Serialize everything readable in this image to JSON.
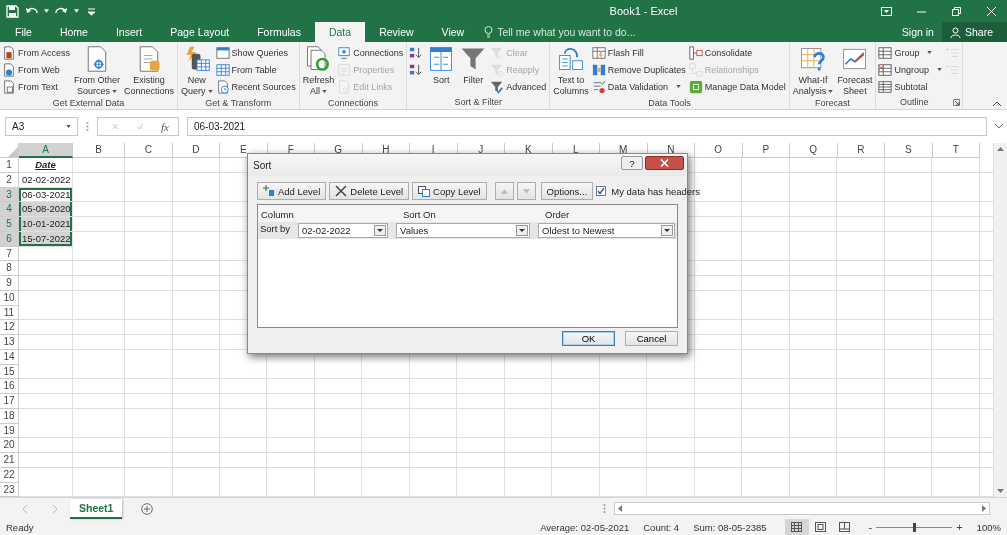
{
  "title_bar": {
    "title": "Book1 - Excel"
  },
  "tabs": [
    {
      "label": "File",
      "selected": false
    },
    {
      "label": "Home",
      "selected": false
    },
    {
      "label": "Insert",
      "selected": false
    },
    {
      "label": "Page Layout",
      "selected": false
    },
    {
      "label": "Formulas",
      "selected": false
    },
    {
      "label": "Data",
      "selected": true
    },
    {
      "label": "Review",
      "selected": false
    },
    {
      "label": "View",
      "selected": false
    }
  ],
  "tell_me": {
    "placeholder": "Tell me what you want to do..."
  },
  "account": {
    "sign_in": "Sign in",
    "share": "Share"
  },
  "ribbon": {
    "groups": [
      {
        "label": "Get External Data",
        "launcher": false,
        "items": [
          {
            "kind": "stack",
            "items": [
              {
                "label": "From Access",
                "disabled": false,
                "dropdown": false
              },
              {
                "label": "From Web",
                "disabled": false,
                "dropdown": false
              },
              {
                "label": "From Text",
                "disabled": false,
                "dropdown": false
              }
            ]
          },
          {
            "kind": "big",
            "lines": [
              "From Other",
              "Sources"
            ],
            "dropdown": true
          },
          {
            "kind": "big",
            "lines": [
              "Existing",
              "Connections"
            ],
            "dropdown": false
          }
        ]
      },
      {
        "label": "Get & Transform",
        "launcher": false,
        "items": [
          {
            "kind": "big",
            "lines": [
              "New",
              "Query"
            ],
            "dropdown": true
          },
          {
            "kind": "stack",
            "items": [
              {
                "label": "Show Queries",
                "disabled": false,
                "dropdown": false
              },
              {
                "label": "From Table",
                "disabled": false,
                "dropdown": false
              },
              {
                "label": "Recent Sources",
                "disabled": false,
                "dropdown": false
              }
            ]
          }
        ]
      },
      {
        "label": "Connections",
        "launcher": false,
        "items": [
          {
            "kind": "big",
            "lines": [
              "Refresh",
              "All"
            ],
            "dropdown": true
          },
          {
            "kind": "stack",
            "items": [
              {
                "label": "Connections",
                "disabled": false,
                "dropdown": false
              },
              {
                "label": "Properties",
                "disabled": true,
                "dropdown": false
              },
              {
                "label": "Edit Links",
                "disabled": true,
                "dropdown": false
              }
            ]
          }
        ]
      },
      {
        "label": "Sort & Filter",
        "launcher": false,
        "items": [
          {
            "kind": "stack",
            "items": [
              {
                "disabled": false,
                "dropdown": false
              },
              {
                "disabled": false,
                "dropdown": false
              }
            ]
          },
          {
            "kind": "big",
            "lines": [
              "Sort"
            ],
            "dropdown": false
          },
          {
            "kind": "big",
            "lines": [
              "Filter"
            ],
            "dropdown": false
          },
          {
            "kind": "stack",
            "items": [
              {
                "label": "Clear",
                "disabled": true,
                "dropdown": false
              },
              {
                "label": "Reapply",
                "disabled": true,
                "dropdown": false
              },
              {
                "label": "Advanced",
                "disabled": false,
                "dropdown": false
              }
            ]
          }
        ]
      },
      {
        "label": "Data Tools",
        "launcher": false,
        "items": [
          {
            "kind": "big",
            "lines": [
              "Text to",
              "Columns"
            ],
            "dropdown": false
          },
          {
            "kind": "stack",
            "items": [
              {
                "label": "Flash Fill",
                "disabled": false,
                "dropdown": false
              },
              {
                "label": "Remove Duplicates",
                "disabled": false,
                "dropdown": false
              },
              {
                "label": "Data Validation",
                "disabled": false,
                "dropdown": true
              }
            ]
          },
          {
            "kind": "stack",
            "items": [
              {
                "label": "Consolidate",
                "disabled": false,
                "dropdown": false
              },
              {
                "label": "Relationships",
                "disabled": true,
                "dropdown": false
              },
              {
                "label": "Manage Data Model",
                "disabled": false,
                "dropdown": false
              }
            ]
          }
        ]
      },
      {
        "label": "Forecast",
        "launcher": false,
        "items": [
          {
            "kind": "big",
            "lines": [
              "What-If",
              "Analysis"
            ],
            "dropdown": true
          },
          {
            "kind": "big",
            "lines": [
              "Forecast",
              "Sheet"
            ],
            "dropdown": false
          }
        ]
      },
      {
        "label": "Outline",
        "launcher": true,
        "items": [
          {
            "kind": "stack",
            "items": [
              {
                "label": "Group",
                "disabled": false,
                "dropdown": true
              },
              {
                "label": "Ungroup",
                "disabled": false,
                "dropdown": true
              },
              {
                "label": "Subtotal",
                "disabled": false,
                "dropdown": false
              }
            ]
          },
          {
            "kind": "stack",
            "items": [
              {
                "disabled": true,
                "dropdown": false
              },
              {
                "disabled": true,
                "dropdown": false
              }
            ]
          }
        ]
      }
    ]
  },
  "formula_bar": {
    "name_box": "A3",
    "function_label": "fx",
    "value": "06-03-2021"
  },
  "sheet": {
    "columns": [
      {
        "label": "A",
        "selected": true
      },
      {
        "label": "B",
        "selected": false
      },
      {
        "label": "C",
        "selected": false
      },
      {
        "label": "D",
        "selected": false
      },
      {
        "label": "E",
        "selected": false
      },
      {
        "label": "F",
        "selected": false
      },
      {
        "label": "G",
        "selected": false
      },
      {
        "label": "H",
        "selected": false
      },
      {
        "label": "I",
        "selected": false
      },
      {
        "label": "J",
        "selected": false
      },
      {
        "label": "K",
        "selected": false
      },
      {
        "label": "L",
        "selected": false
      },
      {
        "label": "M",
        "selected": false
      },
      {
        "label": "N",
        "selected": false
      },
      {
        "label": "O",
        "selected": false
      },
      {
        "label": "P",
        "selected": false
      },
      {
        "label": "Q",
        "selected": false
      },
      {
        "label": "R",
        "selected": false
      },
      {
        "label": "S",
        "selected": false
      },
      {
        "label": "T",
        "selected": false
      }
    ],
    "rows": [
      {
        "label": "1",
        "selected": false
      },
      {
        "label": "2",
        "selected": false
      },
      {
        "label": "3",
        "selected": true
      },
      {
        "label": "4",
        "selected": true
      },
      {
        "label": "5",
        "selected": true
      },
      {
        "label": "6",
        "selected": true
      },
      {
        "label": "7",
        "selected": false
      },
      {
        "label": "8",
        "selected": false
      },
      {
        "label": "9",
        "selected": false
      },
      {
        "label": "10",
        "selected": false
      },
      {
        "label": "11",
        "selected": false
      },
      {
        "label": "12",
        "selected": false
      },
      {
        "label": "13",
        "selected": false
      },
      {
        "label": "14",
        "selected": false
      },
      {
        "label": "15",
        "selected": false
      },
      {
        "label": "16",
        "selected": false
      },
      {
        "label": "17",
        "selected": false
      },
      {
        "label": "18",
        "selected": false
      },
      {
        "label": "19",
        "selected": false
      },
      {
        "label": "20",
        "selected": false
      },
      {
        "label": "21",
        "selected": false
      },
      {
        "label": "22",
        "selected": false
      },
      {
        "label": "23",
        "selected": false
      }
    ],
    "cells": [
      {
        "text": "Date",
        "kind": "header",
        "selected": false,
        "active": false
      },
      {
        "text": "02-02-2022",
        "kind": "value",
        "selected": false,
        "active": false
      },
      {
        "text": "06-03-2021",
        "kind": "value",
        "selected": true,
        "active": true
      },
      {
        "text": "05-08-2020",
        "kind": "value",
        "selected": true,
        "active": false
      },
      {
        "text": "10-01-2021",
        "kind": "value",
        "selected": true,
        "active": false
      },
      {
        "text": "15-07-2022",
        "kind": "value",
        "selected": true,
        "active": false
      }
    ]
  },
  "sort_dialog": {
    "title": "Sort",
    "help": "?",
    "toolbar": [
      {
        "label": "Add Level",
        "disabled": false
      },
      {
        "label": "Delete Level",
        "disabled": false
      },
      {
        "label": "Copy Level",
        "disabled": false
      }
    ],
    "move_buttons": [
      {
        "disabled": true
      },
      {
        "disabled": true
      }
    ],
    "options": "Options...",
    "headers_checkbox": {
      "label": "My data has headers",
      "checked": true
    },
    "columns": [
      "Column",
      "Sort On",
      "Order"
    ],
    "levels": [
      {
        "label": "Sort by",
        "column": "02-02-2022",
        "sort_on": "Values",
        "order": "Oldest to Newest"
      }
    ],
    "buttons": [
      {
        "label": "OK",
        "default": true
      },
      {
        "label": "Cancel",
        "default": false
      }
    ]
  },
  "sheet_tabs": [
    {
      "label": "Sheet1",
      "selected": true
    }
  ],
  "status_bar": {
    "mode": "Ready",
    "stats": [
      "Average: 02-05-2021",
      "Count: 4",
      "Sum: 08-05-2385"
    ],
    "views": [
      {
        "selected": true
      },
      {
        "selected": false
      },
      {
        "selected": false
      }
    ],
    "zoom": {
      "minus": "-",
      "plus": "+",
      "level": 0.5,
      "reading": "100%"
    }
  }
}
